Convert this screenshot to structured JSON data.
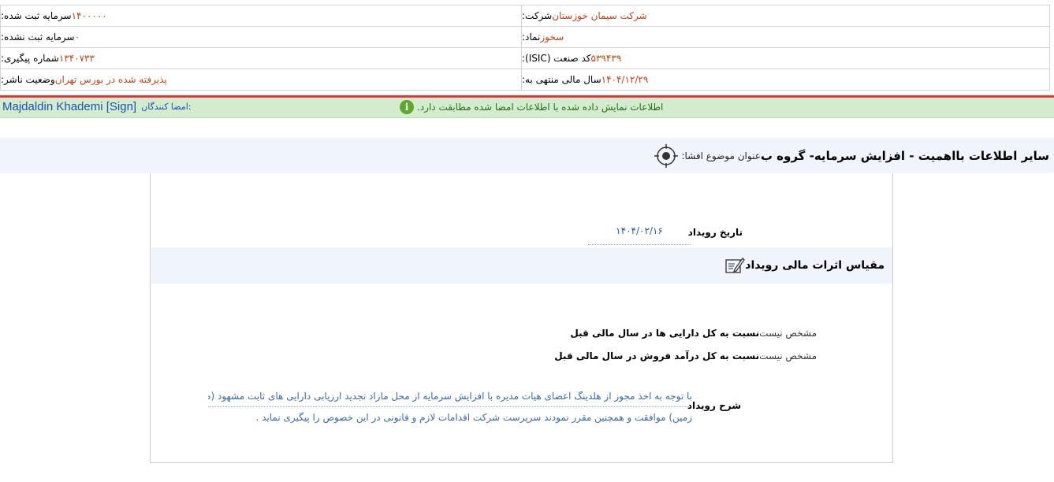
{
  "header": {
    "rows": [
      {
        "right": {
          "label": "شرکت:",
          "value": "شرکت سیمان خوزستان"
        },
        "left": {
          "label": "سرمایه ثبت شده:",
          "value": "۱۴۰۰۰۰۰"
        }
      },
      {
        "right": {
          "label": "نماد:",
          "value": "سخوز"
        },
        "left": {
          "label": "سرمایه ثبت نشده:",
          "value": "۰"
        }
      },
      {
        "right": {
          "label": "کد صنعت (ISIC):",
          "value": "۵۳۹۴۳۹"
        },
        "left": {
          "label": "شماره پیگیری:",
          "value": "۱۳۴۰۷۳۳"
        }
      },
      {
        "right": {
          "label": "سال مالی منتهی به:",
          "value": "۱۴۰۴/۱۲/۲۹"
        },
        "left": {
          "label": "وضعیت ناشر:",
          "value": "پذیرفته شده در بورس تهران"
        }
      }
    ]
  },
  "signature": {
    "signers_label": "امضا کنندگان:",
    "signer": "Majdaldin Khademi [Sign]",
    "message": "اطلاعات نمایش داده شده با اطلاعات امضا شده مطابقت دارد.",
    "info_icon": "info-circle-icon"
  },
  "title": {
    "label": "عنوان موضوع افشا:",
    "text": "سایر اطلاعات بااهمیت - افزایش سرمایه- گروه ب"
  },
  "event": {
    "date_label": "تاریخ رویداد",
    "date_value": "۱۴۰۴/۰۲/۱۶",
    "section_title": "مقیاس اثرات مالی رویداد",
    "ratios": [
      {
        "label": "نسبت به کل دارایی ها در سال مالی قبل",
        "value": "مشخص نیست"
      },
      {
        "label": "نسبت به کل درآمد فروش در سال مالی قبل",
        "value": "مشخص نیست"
      }
    ],
    "description_label": "شرح رویداد",
    "description_lines": [
      "با توجه به اخذ مجوز از هلدینگ اعضای هیات مدیره با افزایش سرمایه از محل مازاد تجدید ارزیابی دارایی های ثابت مشهود (طبقه",
      "زمین) موافقت و همچنین مقرر نمودند سرپرست شرکت اقدامات لازم و قانونی در این خصوص را پیگیری نماید ."
    ]
  },
  "colors": {
    "value_orange": "#c0441a",
    "link_blue": "#1f4fb8",
    "green_bar": "#d3ecce",
    "red_line": "#e8373a",
    "title_bg": "#eff5fb"
  }
}
